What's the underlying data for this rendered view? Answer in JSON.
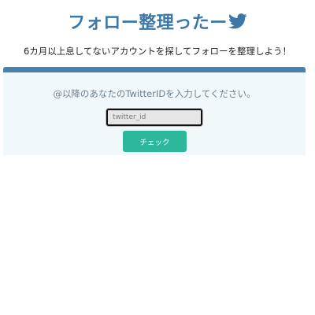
{
  "header": {
    "title": "フォロー整理ったー",
    "icon": "twitter-bird-icon",
    "icon_color": "#3b78a8"
  },
  "subtitle": "6カ月以上息してないアカウントを探してフォローを整理しよう！",
  "panel": {
    "accent_color": "#4a7fae",
    "instruction": "@以降のあなたのTwitterIDを入力してください。",
    "input": {
      "value": "",
      "placeholder": "twitter_id"
    },
    "button": {
      "label": "チェック",
      "color": "#2db89b"
    }
  }
}
